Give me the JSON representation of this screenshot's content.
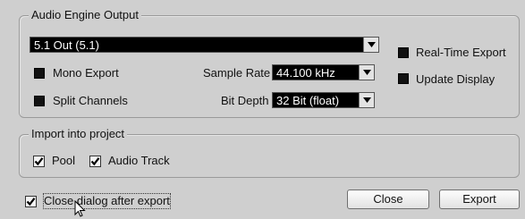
{
  "audio_engine_output": {
    "title": "Audio Engine Output",
    "output_select": "5.1 Out (5.1)",
    "real_time_export": "Real-Time Export",
    "update_display": "Update Display",
    "mono_export": "Mono Export",
    "split_channels": "Split Channels",
    "sample_rate_label": "Sample Rate",
    "sample_rate_value": "44.100 kHz",
    "bit_depth_label": "Bit Depth",
    "bit_depth_value": "32 Bit (float)"
  },
  "import_into_project": {
    "title": "Import into project",
    "pool": "Pool",
    "audio_track": "Audio Track"
  },
  "footer": {
    "close_dialog_after_export": "Close dialog after export",
    "close_button": "Close",
    "export_button": "Export"
  }
}
